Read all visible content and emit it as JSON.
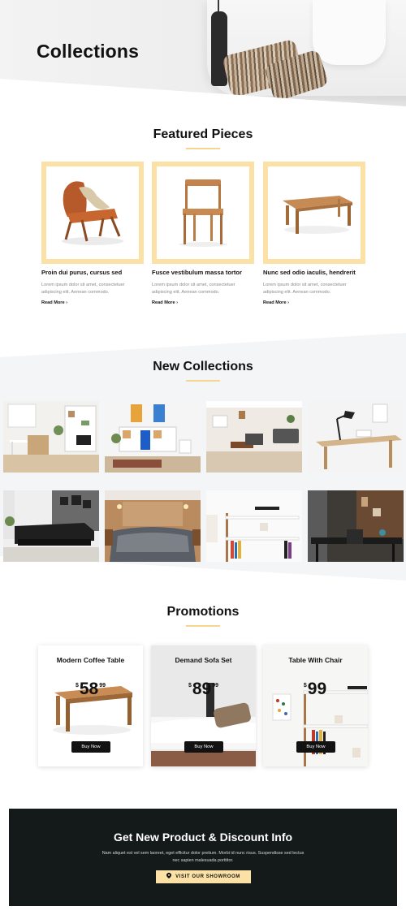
{
  "hero": {
    "title": "Collections"
  },
  "featured": {
    "title": "Featured Pieces",
    "items": [
      {
        "name": "Proin dui purus, cursus sed",
        "desc": "Lorem ipsum dolor sit amet, consectetuer adipiscing elit. Aenean commodo.",
        "link": "Read More"
      },
      {
        "name": "Fusce vestibulum massa tortor",
        "desc": "Lorem ipsum dolor sit amet, consectetuer adipiscing elit. Aenean commodo.",
        "link": "Read More"
      },
      {
        "name": "Nunc sed odio iaculis, hendrerit",
        "desc": "Lorem ipsum dolor sit amet, consectetuer adipiscing elit. Aenean commodo.",
        "link": "Read More"
      }
    ],
    "link_arrow": "›"
  },
  "new_collections": {
    "title": "New Collections"
  },
  "promotions": {
    "title": "Promotions",
    "items": [
      {
        "title": "Modern Coffee Table",
        "currency": "$",
        "price": "58",
        "cents": "99",
        "button": "Buy Now"
      },
      {
        "title": "Demand Sofa Set",
        "currency": "$",
        "price": "89",
        "cents": "99",
        "button": "Buy Now"
      },
      {
        "title": "Table With Chair",
        "currency": "$",
        "price": "99",
        "cents": "",
        "button": "Buy Now"
      }
    ]
  },
  "newsletter": {
    "title": "Get New Product & Discount Info",
    "text": "Nam aliquet est vel sem laoreet, eget efficitur dolor pretium. Morbi id nunc risus. Suspendisse sed lectus nec sapien malesuada porttitor.",
    "button": "VISIT OUR SHOWROOM",
    "button_icon": "map-pin-icon"
  },
  "colors": {
    "accent": "#fbe1a6",
    "dark": "#141a1a",
    "band": "#f4f5f7"
  }
}
